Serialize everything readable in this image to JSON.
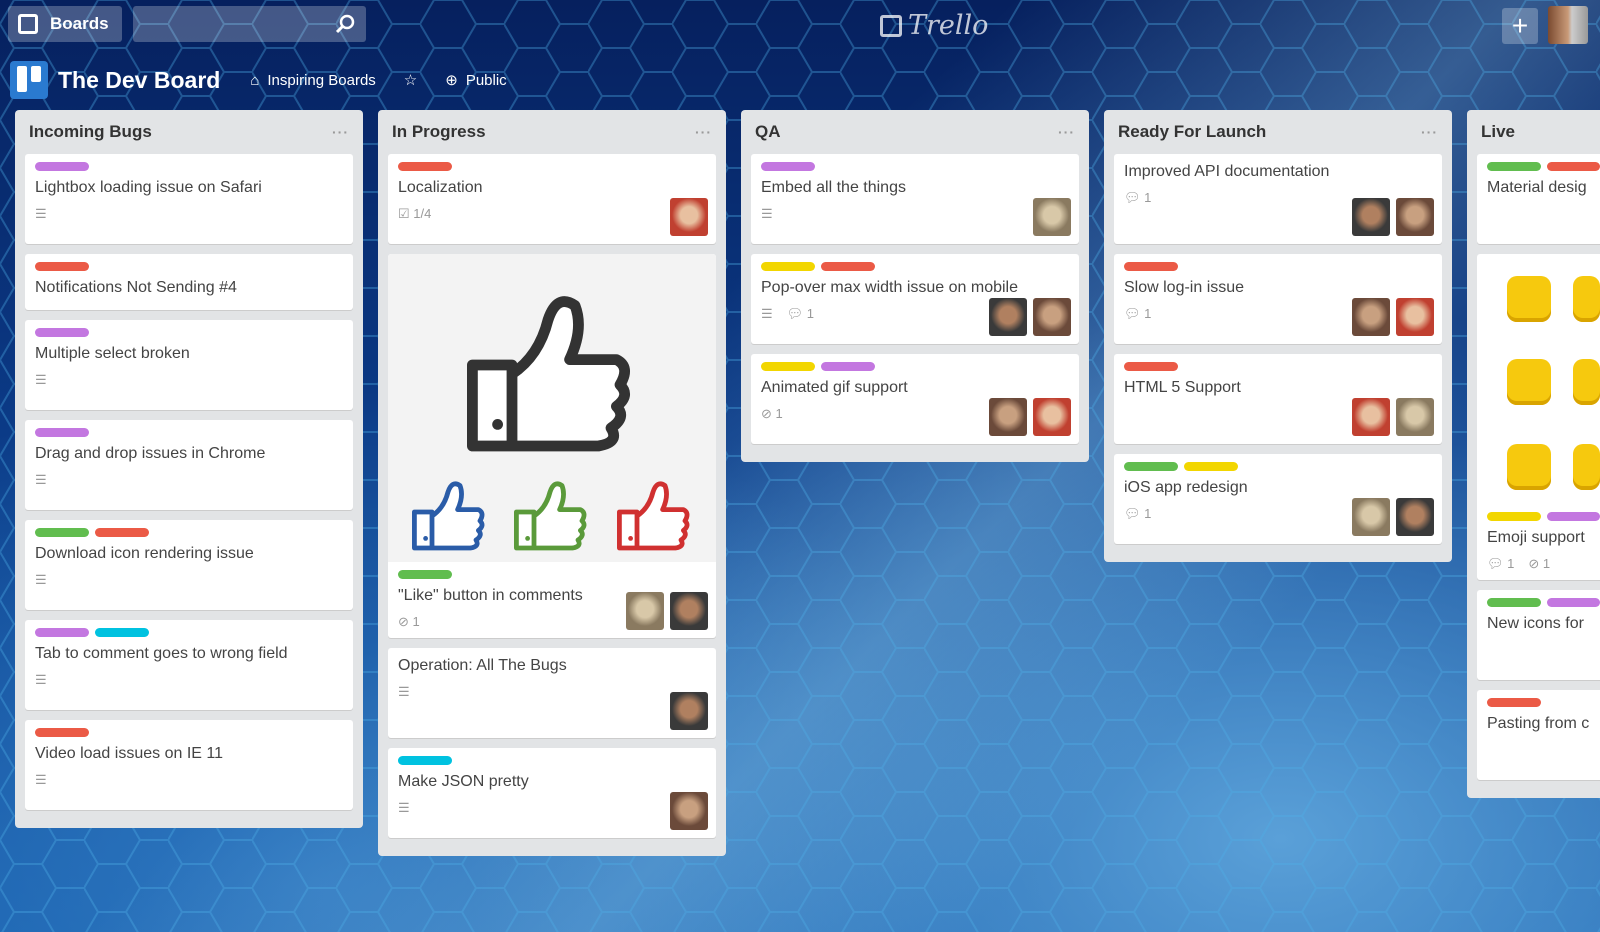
{
  "topbar": {
    "boards_label": "Boards",
    "logo": "Trello",
    "search_icon": "magnifier",
    "add_icon": "plus"
  },
  "board": {
    "title": "The Dev Board",
    "team": "Inspiring Boards",
    "visibility": "Public"
  },
  "colors": {
    "green": "#61bd4f",
    "red": "#eb5a46",
    "purple": "#c377e0",
    "blue": "#00c2e0",
    "yellow": "#f2d600"
  },
  "lists": [
    {
      "title": "Incoming Bugs",
      "cards": [
        {
          "labels": [
            "purple"
          ],
          "title": "Lightbox loading issue on Safari",
          "desc": true
        },
        {
          "labels": [
            "red"
          ],
          "title": "Notifications Not Sending #4"
        },
        {
          "labels": [
            "purple"
          ],
          "title": "Multiple select broken",
          "desc": true
        },
        {
          "labels": [
            "purple"
          ],
          "title": "Drag and drop issues in Chrome",
          "desc": true
        },
        {
          "labels": [
            "green",
            "red"
          ],
          "title": "Download icon rendering issue",
          "desc": true
        },
        {
          "labels": [
            "purple",
            "blue"
          ],
          "title": "Tab to comment goes to wrong field",
          "desc": true
        },
        {
          "labels": [
            "red"
          ],
          "title": "Video load issues on IE 11",
          "desc": true
        }
      ]
    },
    {
      "title": "In Progress",
      "cards": [
        {
          "labels": [
            "red"
          ],
          "title": "Localization",
          "checklist": "1/4",
          "avatars": 1
        },
        {
          "cover": true,
          "labels": [
            "green"
          ],
          "title": "\"Like\" button in comments",
          "attachments": "1",
          "avatars": 2
        },
        {
          "labels": [],
          "title": "Operation: All The Bugs",
          "desc": true,
          "avatars": 1
        },
        {
          "labels": [
            "blue"
          ],
          "title": "Make JSON pretty",
          "desc": true,
          "avatars": 1
        }
      ]
    },
    {
      "title": "QA",
      "cards": [
        {
          "labels": [
            "purple"
          ],
          "title": "Embed all the things",
          "desc": true,
          "avatars": 1
        },
        {
          "labels": [
            "yellow",
            "red"
          ],
          "title": "Pop-over max width issue on mobile",
          "desc": true,
          "comments": "1",
          "avatars": 2
        },
        {
          "labels": [
            "yellow",
            "purple"
          ],
          "title": "Animated gif support",
          "attachments": "1",
          "avatars": 2
        }
      ]
    },
    {
      "title": "Ready For Launch",
      "cards": [
        {
          "labels": [],
          "title": "Improved API documentation",
          "comments": "1",
          "avatars": 2
        },
        {
          "labels": [
            "red"
          ],
          "title": "Slow log-in issue",
          "comments": "1",
          "avatars": 2
        },
        {
          "labels": [
            "red"
          ],
          "title": "HTML 5 Support",
          "avatars": 2
        },
        {
          "labels": [
            "green",
            "yellow"
          ],
          "title": "iOS app redesign",
          "comments": "1",
          "avatars": 2
        }
      ]
    },
    {
      "title": "Live",
      "cards": [
        {
          "labels": [
            "green",
            "red"
          ],
          "title": "Material desig"
        },
        {
          "emoji": true,
          "labels": [
            "yellow",
            "purple"
          ],
          "title": "Emoji support",
          "comments": "1",
          "attachments": "1"
        },
        {
          "labels": [
            "green",
            "purple"
          ],
          "title": "New icons for"
        },
        {
          "labels": [
            "red"
          ],
          "title": "Pasting from c"
        }
      ]
    }
  ]
}
